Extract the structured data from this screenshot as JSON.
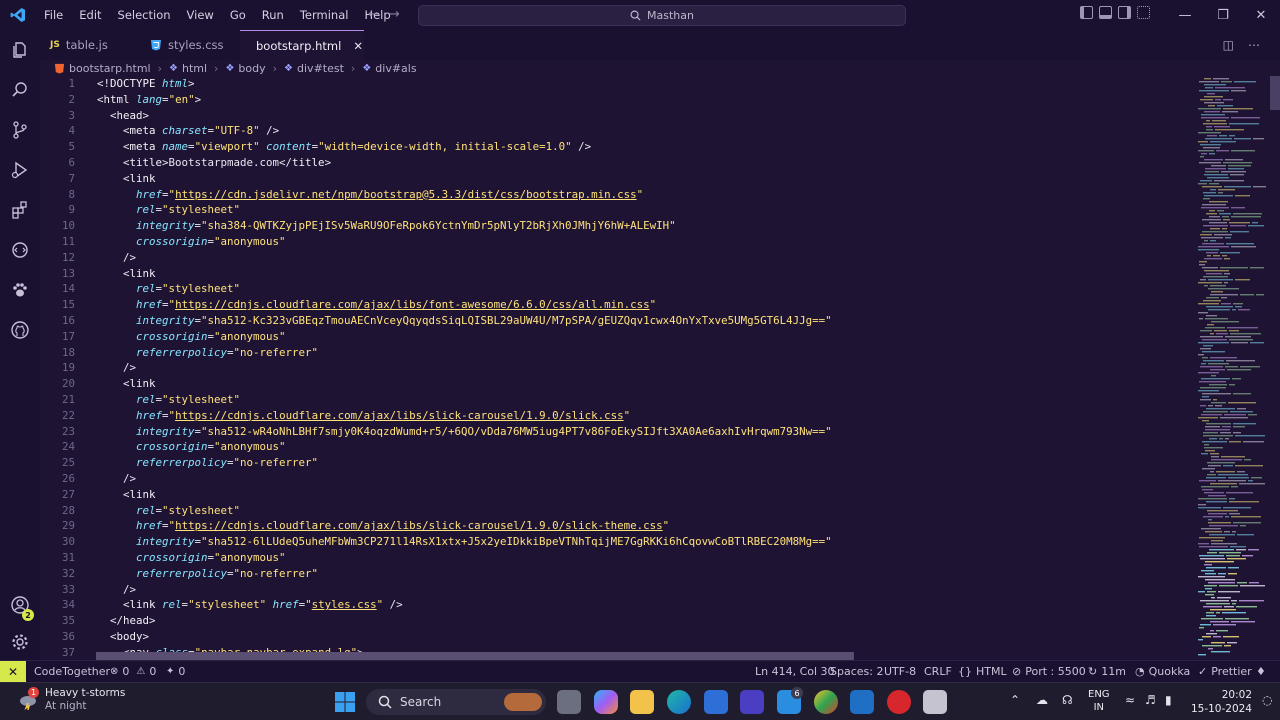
{
  "menu": [
    "File",
    "Edit",
    "Selection",
    "View",
    "Go",
    "Run",
    "Terminal",
    "Help"
  ],
  "command_center": {
    "text": "Masthan"
  },
  "tabs": [
    {
      "label": "table.js",
      "icon": "JS",
      "active": false
    },
    {
      "label": "styles.css",
      "icon": "css",
      "active": false
    },
    {
      "label": "bootstarp.html",
      "icon": "html",
      "active": true
    }
  ],
  "breadcrumb": [
    "bootstarp.html",
    "html",
    "body",
    "div#test",
    "div#als"
  ],
  "code_lines": [
    {
      "n": "1",
      "seg": [
        [
          "p",
          "<!"
        ],
        [
          "t",
          "DOCTYPE "
        ],
        [
          "a",
          "html"
        ],
        [
          "p",
          ">"
        ]
      ]
    },
    {
      "n": "2",
      "seg": [
        [
          "p",
          "<"
        ],
        [
          "t",
          "html "
        ],
        [
          "a",
          "lang"
        ],
        [
          "p",
          "="
        ],
        [
          "s",
          "\"en\""
        ],
        [
          "p",
          ">"
        ]
      ]
    },
    {
      "n": "3",
      "seg": [
        [
          "p",
          "  <"
        ],
        [
          "t",
          "head"
        ],
        [
          "p",
          ">"
        ]
      ]
    },
    {
      "n": "4",
      "seg": [
        [
          "p",
          "    <"
        ],
        [
          "t",
          "meta "
        ],
        [
          "a",
          "charset"
        ],
        [
          "p",
          "="
        ],
        [
          "s",
          "\"UTF-8\""
        ],
        [
          "p",
          " />"
        ]
      ]
    },
    {
      "n": "5",
      "seg": [
        [
          "p",
          "    <"
        ],
        [
          "t",
          "meta "
        ],
        [
          "a",
          "name"
        ],
        [
          "p",
          "="
        ],
        [
          "s",
          "\"viewport\" "
        ],
        [
          "a",
          "content"
        ],
        [
          "p",
          "="
        ],
        [
          "s",
          "\"width=device-width, initial-scale=1.0\""
        ],
        [
          "p",
          " />"
        ]
      ]
    },
    {
      "n": "6",
      "seg": [
        [
          "p",
          "    <"
        ],
        [
          "t",
          "title"
        ],
        [
          "p",
          ">Bootstarpmade.com</"
        ],
        [
          "t",
          "title"
        ],
        [
          "p",
          ">"
        ]
      ]
    },
    {
      "n": "7",
      "seg": [
        [
          "p",
          "    <"
        ],
        [
          "t",
          "link"
        ]
      ]
    },
    {
      "n": "8",
      "seg": [
        [
          "p",
          "      "
        ],
        [
          "a",
          "href"
        ],
        [
          "p",
          "="
        ],
        [
          "s",
          "\""
        ],
        [
          "su",
          "https://cdn.jsdelivr.net/npm/bootstrap@5.3.3/dist/css/bootstrap.min.css"
        ],
        [
          "s",
          "\""
        ]
      ]
    },
    {
      "n": "9",
      "seg": [
        [
          "p",
          "      "
        ],
        [
          "a",
          "rel"
        ],
        [
          "p",
          "="
        ],
        [
          "s",
          "\"stylesheet\""
        ]
      ]
    },
    {
      "n": "10",
      "seg": [
        [
          "p",
          "      "
        ],
        [
          "a",
          "integrity"
        ],
        [
          "p",
          "="
        ],
        [
          "s",
          "\"sha384-QWTKZyjpPEjISv5WaRU9OFeRpok6YctnYmDr5pNlyT2bRjXh0JMhjY6hW+ALEwIH\""
        ]
      ]
    },
    {
      "n": "11",
      "seg": [
        [
          "p",
          "      "
        ],
        [
          "a",
          "crossorigin"
        ],
        [
          "p",
          "="
        ],
        [
          "s",
          "\"anonymous\""
        ]
      ]
    },
    {
      "n": "12",
      "seg": [
        [
          "p",
          "    />"
        ]
      ]
    },
    {
      "n": "13",
      "seg": [
        [
          "p",
          "    <"
        ],
        [
          "t",
          "link"
        ]
      ]
    },
    {
      "n": "14",
      "seg": [
        [
          "p",
          "      "
        ],
        [
          "a",
          "rel"
        ],
        [
          "p",
          "="
        ],
        [
          "s",
          "\"stylesheet\""
        ]
      ]
    },
    {
      "n": "15",
      "seg": [
        [
          "p",
          "      "
        ],
        [
          "a",
          "href"
        ],
        [
          "p",
          "="
        ],
        [
          "s",
          "\""
        ],
        [
          "su",
          "https://cdnjs.cloudflare.com/ajax/libs/font-awesome/6.6.0/css/all.min.css"
        ],
        [
          "s",
          "\""
        ]
      ]
    },
    {
      "n": "16",
      "seg": [
        [
          "p",
          "      "
        ],
        [
          "a",
          "integrity"
        ],
        [
          "p",
          "="
        ],
        [
          "s",
          "\"sha512-Kc323vGBEqzTmouAECnVceyQqyqdsSiqLQISBL29aUW4U/M7pSPA/gEUZQqv1cwx4OnYxTxve5UMg5GT6L4JJg==\""
        ]
      ]
    },
    {
      "n": "17",
      "seg": [
        [
          "p",
          "      "
        ],
        [
          "a",
          "crossorigin"
        ],
        [
          "p",
          "="
        ],
        [
          "s",
          "\"anonymous\""
        ]
      ]
    },
    {
      "n": "18",
      "seg": [
        [
          "p",
          "      "
        ],
        [
          "a",
          "referrerpolicy"
        ],
        [
          "p",
          "="
        ],
        [
          "s",
          "\"no-referrer\""
        ]
      ]
    },
    {
      "n": "19",
      "seg": [
        [
          "p",
          "    />"
        ]
      ]
    },
    {
      "n": "20",
      "seg": [
        [
          "p",
          "    <"
        ],
        [
          "t",
          "link"
        ]
      ]
    },
    {
      "n": "21",
      "seg": [
        [
          "p",
          "      "
        ],
        [
          "a",
          "rel"
        ],
        [
          "p",
          "="
        ],
        [
          "s",
          "\"stylesheet\""
        ]
      ]
    },
    {
      "n": "22",
      "seg": [
        [
          "p",
          "      "
        ],
        [
          "a",
          "href"
        ],
        [
          "p",
          "="
        ],
        [
          "s",
          "\""
        ],
        [
          "su",
          "https://cdnjs.cloudflare.com/ajax/libs/slick-carousel/1.9.0/slick.css"
        ],
        [
          "s",
          "\""
        ]
      ]
    },
    {
      "n": "23",
      "seg": [
        [
          "p",
          "      "
        ],
        [
          "a",
          "integrity"
        ],
        [
          "p",
          "="
        ],
        [
          "s",
          "\"sha512-wR4oNhLBHf7smjy0K4oqzdWumd+r5/+6QO/vDda76MW5iug4PT7v86FoEkySIJft3XA0Ae6axhIvHrqwm793Nw==\""
        ]
      ]
    },
    {
      "n": "24",
      "seg": [
        [
          "p",
          "      "
        ],
        [
          "a",
          "crossorigin"
        ],
        [
          "p",
          "="
        ],
        [
          "s",
          "\"anonymous\""
        ]
      ]
    },
    {
      "n": "25",
      "seg": [
        [
          "p",
          "      "
        ],
        [
          "a",
          "referrerpolicy"
        ],
        [
          "p",
          "="
        ],
        [
          "s",
          "\"no-referrer\""
        ]
      ]
    },
    {
      "n": "26",
      "seg": [
        [
          "p",
          "    />"
        ]
      ]
    },
    {
      "n": "27",
      "seg": [
        [
          "p",
          "    <"
        ],
        [
          "t",
          "link"
        ]
      ]
    },
    {
      "n": "28",
      "seg": [
        [
          "p",
          "      "
        ],
        [
          "a",
          "rel"
        ],
        [
          "p",
          "="
        ],
        [
          "s",
          "\"stylesheet\""
        ]
      ]
    },
    {
      "n": "29",
      "seg": [
        [
          "p",
          "      "
        ],
        [
          "a",
          "href"
        ],
        [
          "p",
          "="
        ],
        [
          "s",
          "\""
        ],
        [
          "su",
          "https://cdnjs.cloudflare.com/ajax/libs/slick-carousel/1.9.0/slick-theme.css"
        ],
        [
          "s",
          "\""
        ]
      ]
    },
    {
      "n": "30",
      "seg": [
        [
          "p",
          "      "
        ],
        [
          "a",
          "integrity"
        ],
        [
          "p",
          "="
        ],
        [
          "s",
          "\"sha512-6lLUdeQ5uheMFbWm3CP271l14RsX1xtx+J5x2yeIDkkiBpeVTNhTqijME7GgRKKi6hCqovwCoBTlRBEC20M8Mg==\""
        ]
      ]
    },
    {
      "n": "31",
      "seg": [
        [
          "p",
          "      "
        ],
        [
          "a",
          "crossorigin"
        ],
        [
          "p",
          "="
        ],
        [
          "s",
          "\"anonymous\""
        ]
      ]
    },
    {
      "n": "32",
      "seg": [
        [
          "p",
          "      "
        ],
        [
          "a",
          "referrerpolicy"
        ],
        [
          "p",
          "="
        ],
        [
          "s",
          "\"no-referrer\""
        ]
      ]
    },
    {
      "n": "33",
      "seg": [
        [
          "p",
          "    />"
        ]
      ]
    },
    {
      "n": "34",
      "seg": [
        [
          "p",
          "    <"
        ],
        [
          "t",
          "link "
        ],
        [
          "a",
          "rel"
        ],
        [
          "p",
          "="
        ],
        [
          "s",
          "\"stylesheet\" "
        ],
        [
          "a",
          "href"
        ],
        [
          "p",
          "="
        ],
        [
          "s",
          "\""
        ],
        [
          "su",
          "styles.css"
        ],
        [
          "s",
          "\""
        ],
        [
          "p",
          " />"
        ]
      ]
    },
    {
      "n": "35",
      "seg": [
        [
          "p",
          "  </"
        ],
        [
          "t",
          "head"
        ],
        [
          "p",
          ">"
        ]
      ]
    },
    {
      "n": "36",
      "seg": [
        [
          "p",
          "  <"
        ],
        [
          "t",
          "body"
        ],
        [
          "p",
          ">"
        ]
      ]
    },
    {
      "n": "37",
      "seg": [
        [
          "p",
          "    <"
        ],
        [
          "t",
          "nav "
        ],
        [
          "a",
          "class"
        ],
        [
          "p",
          "="
        ],
        [
          "s",
          "\"navbar navbar-expand-lg\""
        ],
        [
          "p",
          ">"
        ]
      ]
    }
  ],
  "status": {
    "remote": "✕",
    "codetogether": "CodeTogether",
    "errors": "0",
    "warnings": "0",
    "ports": "0",
    "position": "Ln 414, Col 30",
    "spaces": "Spaces: 2",
    "encoding": "UTF-8",
    "eol": "CRLF",
    "language": "HTML",
    "port": "Port : 5500",
    "time": "11m",
    "quokka": "Quokka",
    "prettier": "Prettier"
  },
  "taskbar": {
    "weather_title": "Heavy t-storms",
    "weather_sub": "At night",
    "weather_badge": "1",
    "search": "Search",
    "badge_count": "6",
    "lang_top": "ENG",
    "lang_bottom": "IN",
    "time": "20:02",
    "date": "15-10-2024"
  },
  "accounts_badge": "2",
  "colors": {
    "accent": "#b78ce8",
    "background": "#1e1333",
    "status_remote": "#d6e84a",
    "string": "#ffe27a",
    "attribute": "#87e5ff"
  }
}
